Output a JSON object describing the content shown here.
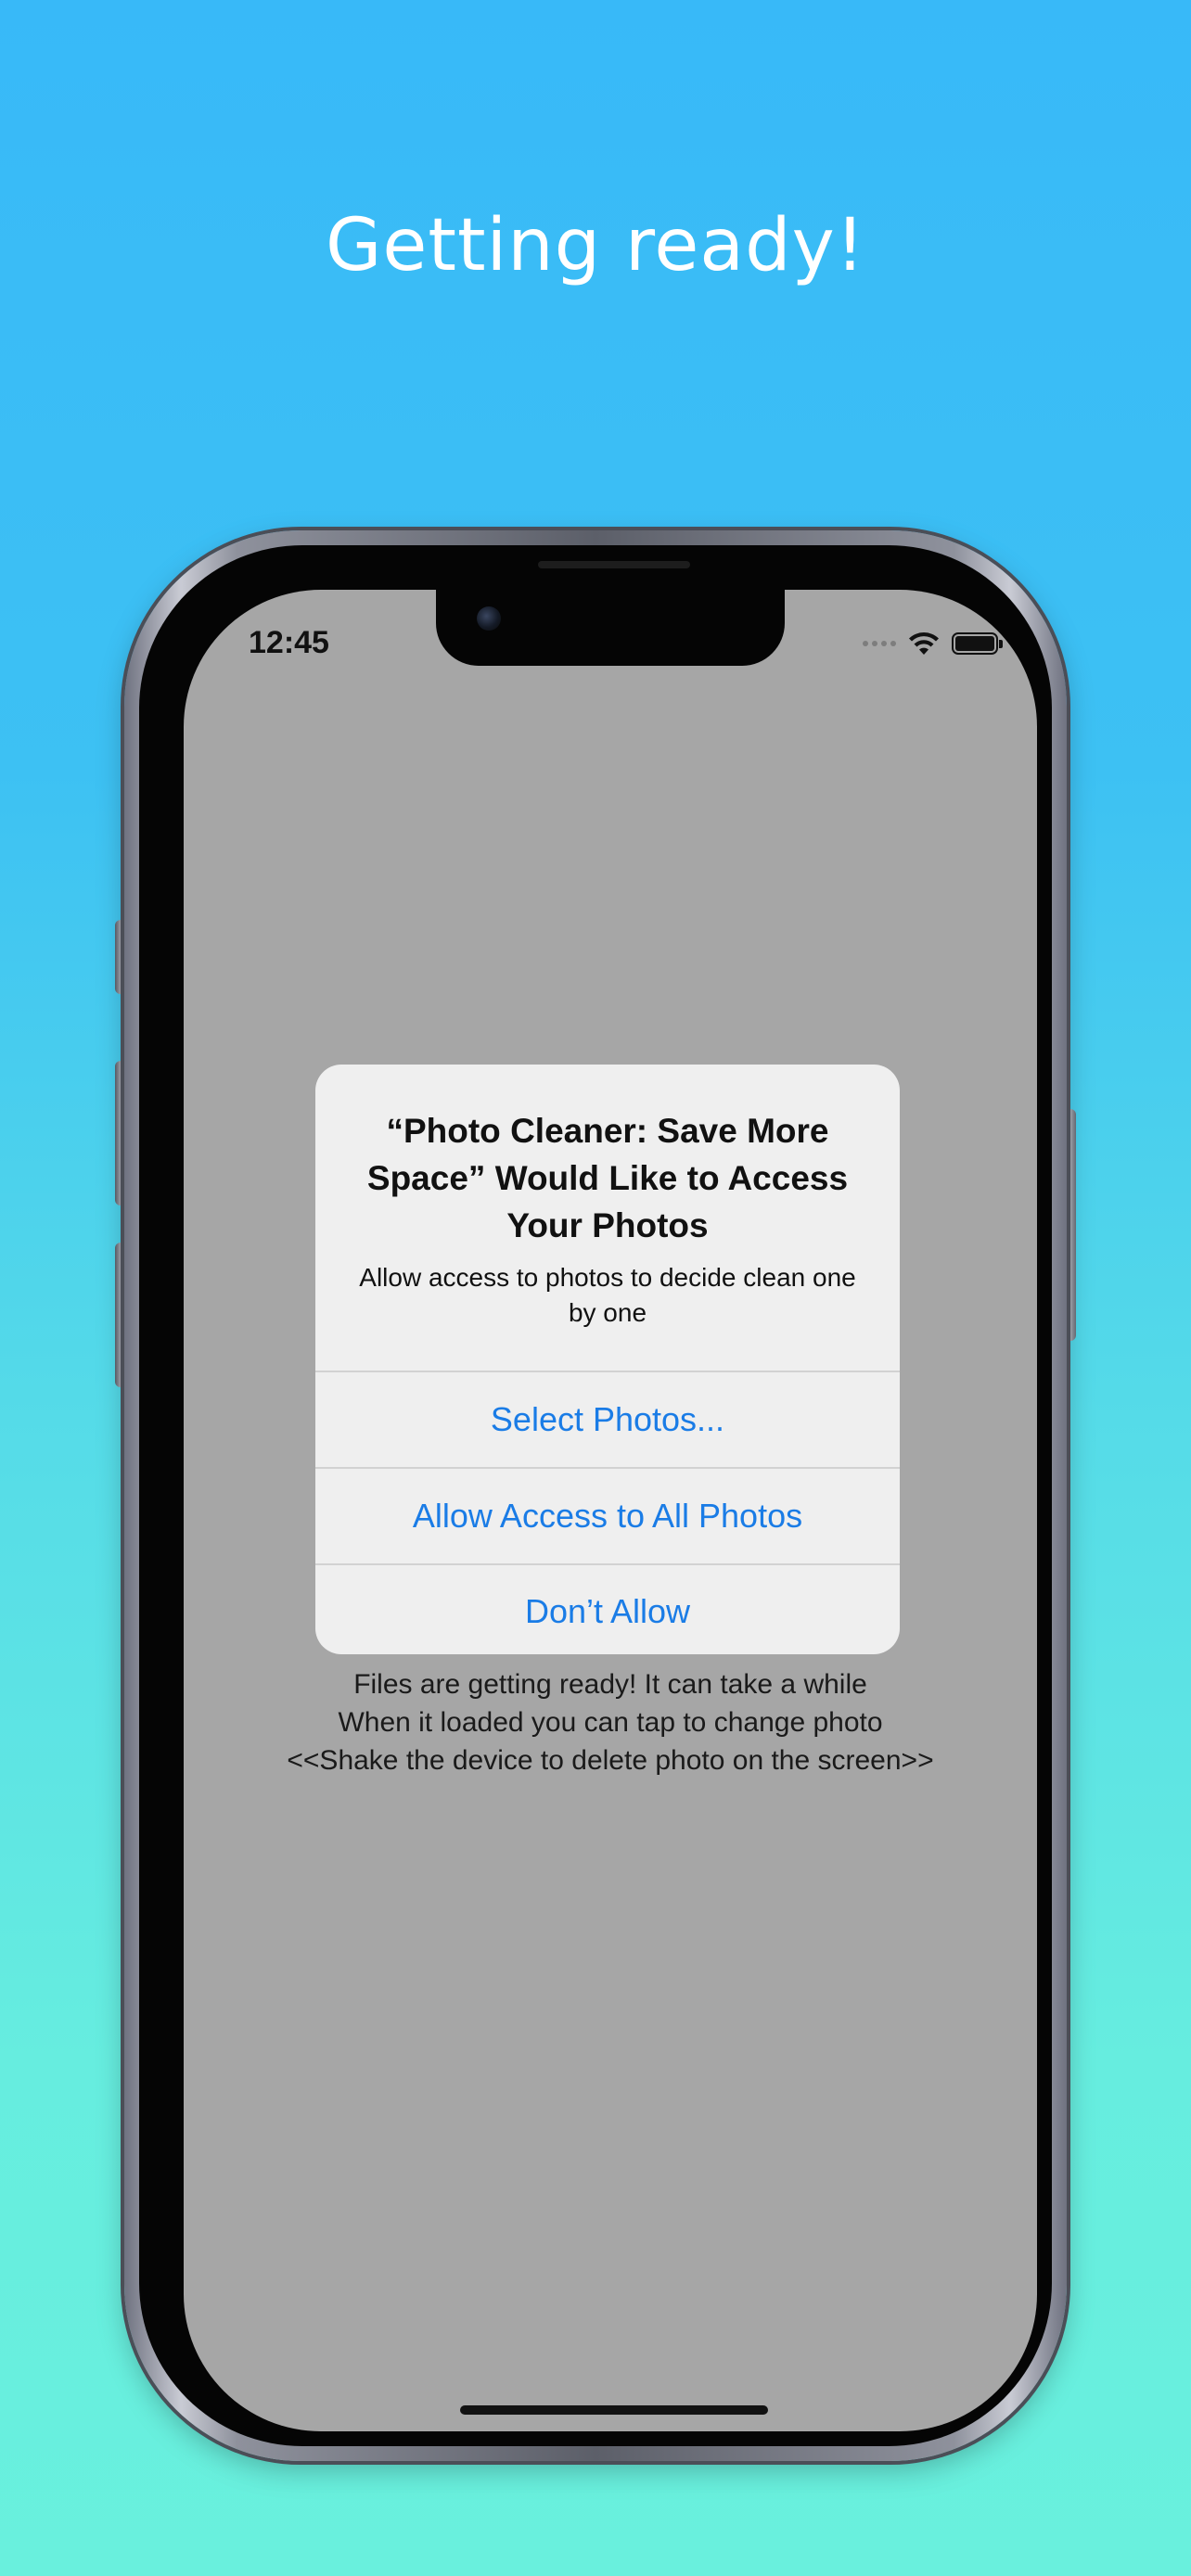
{
  "promo": {
    "headline": "Getting ready!"
  },
  "status_bar": {
    "time": "12:45",
    "icons": [
      "signal-dots-icon",
      "wifi-icon",
      "battery-icon"
    ]
  },
  "alert": {
    "title": "“Photo Cleaner: Save More Space” Would Like to Access Your Photos",
    "message": "Allow access to photos to decide clean one by one",
    "buttons": [
      {
        "label": "Select Photos..."
      },
      {
        "label": "Allow Access to All Photos"
      },
      {
        "label": "Don’t Allow"
      }
    ],
    "button_color": "#1a7ce6"
  },
  "background_text": {
    "lines": [
      "Files are getting ready! It can take a while",
      "When it loaded you can tap to change photo",
      "<<Shake the device to delete photo on the screen>>"
    ]
  },
  "colors": {
    "gradient_top": "#38b9f8",
    "gradient_bottom": "#69f0dd",
    "screen_bg": "#a6a6a6"
  }
}
